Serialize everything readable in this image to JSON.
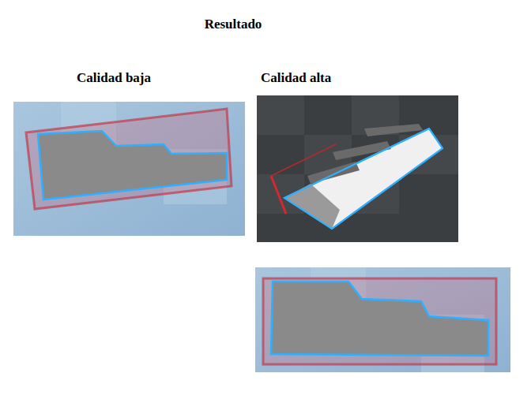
{
  "title": "Resultado",
  "columns": [
    {
      "label": "Calidad baja"
    },
    {
      "label": "Calidad alta"
    }
  ]
}
